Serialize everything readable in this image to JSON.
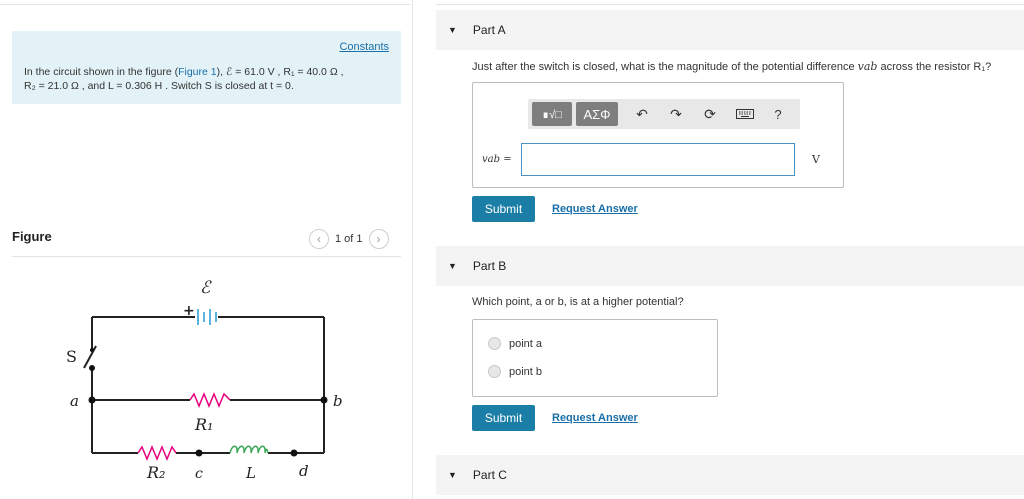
{
  "constants": {
    "link": "Constants",
    "line1_prefix": "In the circuit shown in the figure (",
    "figure_link": "Figure 1",
    "line1_suffix": "), ℰ = 61.0 V , R₁ = 40.0 Ω ,",
    "line2": "R₂ = 21.0 Ω , and L = 0.306 H . Switch S is closed at t = 0."
  },
  "figure": {
    "label": "Figure",
    "pager_text": "1 of 1",
    "prev_icon": "chevron-left-icon",
    "next_icon": "chevron-right-icon"
  },
  "circuit": {
    "emf": "ℰ",
    "plus": "+",
    "switch": "S",
    "point_a": "a",
    "point_b": "b",
    "point_c": "c",
    "point_d": "d",
    "r1": "R₁",
    "r2": "R₂",
    "inductor": "L",
    "resistor_color": "#e6007e",
    "inductor_color": "#3aa655",
    "battery_color": "#5ab4e0"
  },
  "partA": {
    "title": "Part A",
    "question_prefix": "Just after the switch is closed, what is the magnitude of the potential difference ",
    "question_var": "vab",
    "question_suffix": " across the resistor R₁?",
    "toolbar": {
      "template_btn": "∎√□",
      "greek_btn": "ΑΣΦ",
      "undo_icon": "undo-icon",
      "redo_icon": "redo-icon",
      "reset_icon": "reset-icon",
      "keyboard_icon": "keyboard-icon",
      "help": "?"
    },
    "input_label": "vab =",
    "input_value": "",
    "unit": "V",
    "submit": "Submit",
    "request": "Request Answer"
  },
  "partB": {
    "title": "Part B",
    "question": "Which point, a or b, is at a higher potential?",
    "options": [
      "point a",
      "point b"
    ],
    "submit": "Submit",
    "request": "Request Answer"
  },
  "partC": {
    "title": "Part C"
  },
  "colors": {
    "accent": "#1b7ea6",
    "link": "#1a6fa8",
    "constants_bg": "#e2f2f6"
  }
}
